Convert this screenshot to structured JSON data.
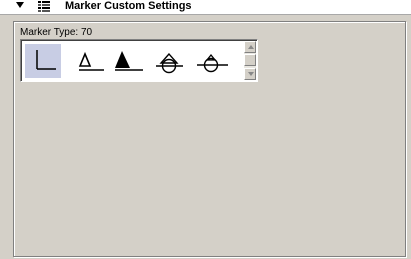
{
  "header": {
    "title": "Marker Custom Settings",
    "collapse_icon": "triangle-down-icon",
    "settings_icon": "grid-list-icon"
  },
  "marker_group": {
    "label": "Marker Type: 70",
    "markers": [
      {
        "icon": "corner-marker-icon",
        "selected": true
      },
      {
        "icon": "hollow-triangle-marker-icon",
        "selected": false
      },
      {
        "icon": "filled-triangle-marker-icon",
        "selected": false
      },
      {
        "icon": "diamond-circle-marker-icon",
        "selected": false
      },
      {
        "icon": "circle-marker-icon",
        "selected": false
      }
    ]
  },
  "colors": {
    "panel_bg": "#d4d0c8",
    "selection_bg": "#c8cde4",
    "header_bg": "#ffffff"
  }
}
